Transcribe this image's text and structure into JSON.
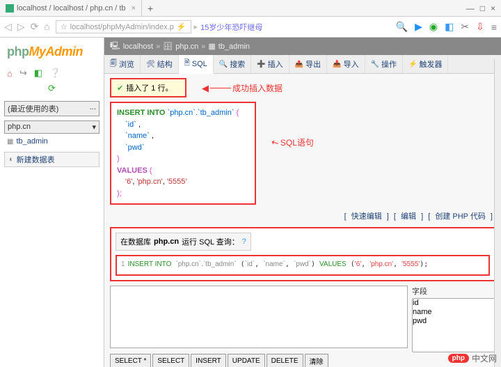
{
  "browser": {
    "tab_title": "localhost / localhost / php.cn / tb",
    "tab_close": "×",
    "new_tab": "+",
    "win_min": "—",
    "win_max": "□",
    "win_close": "×",
    "back": "◁",
    "forward": "▷",
    "reload": "⟳",
    "home": "⌂",
    "addr_prefix": "☆",
    "addr_path": "localhost/phpMyAdmin/index.p",
    "addr_more": "⚡",
    "addr_sep": "▸",
    "news": "15岁少年恐吓继母",
    "icons": {
      "search": "🔍",
      "play": "▶",
      "chat": "◉",
      "square": "◧",
      "cut": "✂",
      "save": "⇩",
      "menu": "≡"
    }
  },
  "sidebar": {
    "logo_a": "php",
    "logo_b": "MyAdmin",
    "icons": {
      "home": "⌂",
      "logout": "↪",
      "sql": "◧",
      "help": "❔",
      "reload": "⟳"
    },
    "recent_label": "(最近使用的表)",
    "recent_more": "...",
    "db_label": "php.cn",
    "tree_item": "tb_admin",
    "new_db": "新建数据表"
  },
  "breadcrumb": {
    "server_icon": "🖳",
    "server": "localhost",
    "sep": "»",
    "db_icon": "🗄",
    "db": "php.cn",
    "tbl_icon": "▦",
    "tbl": "tb_admin"
  },
  "tabs": [
    {
      "icon": "🗐",
      "label": "浏览"
    },
    {
      "icon": "🛠",
      "label": "结构"
    },
    {
      "icon": "🗎",
      "label": "SQL"
    },
    {
      "icon": "🔍",
      "label": "搜索"
    },
    {
      "icon": "➕",
      "label": "插入"
    },
    {
      "icon": "📤",
      "label": "导出"
    },
    {
      "icon": "📥",
      "label": "导入"
    },
    {
      "icon": "🔧",
      "label": "操作"
    },
    {
      "icon": "⚡",
      "label": "触发器"
    }
  ],
  "success": {
    "check": "✔",
    "msg": "插入了 1 行。"
  },
  "annotations": {
    "success_label": "成功插入数据",
    "sql_label": "SQL语句"
  },
  "sql_display": {
    "kw_insert": "INSERT INTO",
    "table_ref": "`php.cn`.`tb_admin`",
    "col1": "`id`",
    "col2": "`name`",
    "col3": "`pwd`",
    "kw_values": "VALUES",
    "v1": "'6'",
    "v2": "'php.cn'",
    "v3": "'5555'"
  },
  "quick": {
    "edit_inline": "快速编辑",
    "edit": "编辑",
    "create_php": "创建 PHP 代码",
    "l": "[ ",
    "r": " ]"
  },
  "query_panel": {
    "title_a": "在数据库 ",
    "title_db": "php.cn",
    "title_b": " 运行 SQL 查询：",
    "help": "?",
    "line_no": "1",
    "text": "INSERT INTO `php.cn`.`tb_admin` (`id`, `name`, `pwd`) VALUES ('6', 'php.cn', '5555');"
  },
  "fields": {
    "header": "字段",
    "items": [
      "id",
      "name",
      "pwd"
    ]
  },
  "buttons": [
    "SELECT *",
    "SELECT",
    "INSERT",
    "UPDATE",
    "DELETE",
    "清除"
  ],
  "watermark": {
    "pill": "php",
    "text": "中文网"
  }
}
